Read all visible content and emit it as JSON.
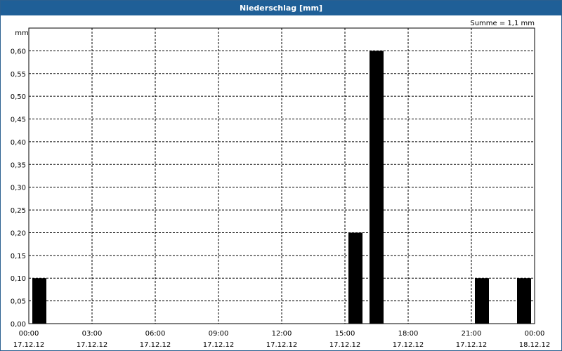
{
  "window": {
    "title": "Niederschlag [mm]"
  },
  "chart_data": {
    "type": "bar",
    "ylabel": "mm",
    "summary": "Summe = 1,1 mm",
    "ylim": [
      0,
      0.65
    ],
    "yticks": [
      "0,00",
      "0,05",
      "0,10",
      "0,15",
      "0,20",
      "0,25",
      "0,30",
      "0,35",
      "0,40",
      "0,45",
      "0,50",
      "0,55",
      "0,60"
    ],
    "x_range_hours": [
      0,
      24
    ],
    "xticks": [
      {
        "hour": 0,
        "time": "00:00",
        "date": "17.12.12"
      },
      {
        "hour": 3,
        "time": "03:00",
        "date": "17.12.12"
      },
      {
        "hour": 6,
        "time": "06:00",
        "date": "17.12.12"
      },
      {
        "hour": 9,
        "time": "09:00",
        "date": "17.12.12"
      },
      {
        "hour": 12,
        "time": "12:00",
        "date": "17.12.12"
      },
      {
        "hour": 15,
        "time": "15:00",
        "date": "17.12.12"
      },
      {
        "hour": 18,
        "time": "18:00",
        "date": "17.12.12"
      },
      {
        "hour": 21,
        "time": "21:00",
        "date": "17.12.12"
      },
      {
        "hour": 24,
        "time": "00:00",
        "date": "18.12.12"
      }
    ],
    "bars": [
      {
        "hour": 0,
        "value": 0.1
      },
      {
        "hour": 15,
        "value": 0.2
      },
      {
        "hour": 16,
        "value": 0.6
      },
      {
        "hour": 21,
        "value": 0.1
      },
      {
        "hour": 23,
        "value": 0.1
      }
    ],
    "bar_color": "#000000",
    "grid": true
  }
}
